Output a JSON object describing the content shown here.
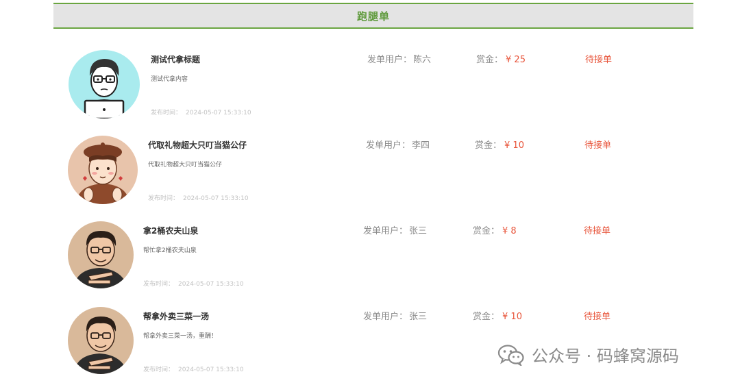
{
  "header": {
    "title": "跑腿单"
  },
  "labels": {
    "poster": "发单用户：",
    "reward": "赏金：",
    "time": "发布时间："
  },
  "orders": [
    {
      "title": "测试代拿标题",
      "content": "测试代拿内容",
      "time": "2024-05-07 15:33:10",
      "poster": "陈六",
      "reward": "¥ 25",
      "status": "待接单",
      "avatar": "cartoon-man-laptop"
    },
    {
      "title": "代取礼物超大只叮当猫公仔",
      "content": "代取礼物超大只叮当猫公仔",
      "time": "2024-05-07 15:33:10",
      "poster": "李四",
      "reward": "¥ 10",
      "status": "待接单",
      "avatar": "cartoon-boy-beret"
    },
    {
      "title": "拿2桶农夫山泉",
      "content": "帮忙拿2桶农夫山泉",
      "time": "2024-05-07 15:33:10",
      "poster": "张三",
      "reward": "¥ 8",
      "status": "待接单",
      "avatar": "cartoon-man-glasses"
    },
    {
      "title": "帮拿外卖三菜一汤",
      "content": "帮拿外卖三菜一汤，重酬！",
      "time": "2024-05-07 15:33:10",
      "poster": "张三",
      "reward": "¥ 10",
      "status": "待接单",
      "avatar": "cartoon-man-glasses"
    }
  ],
  "watermark": {
    "text": "公众号 · 码蜂窝源码",
    "icon": "wechat-icon"
  },
  "colors": {
    "accent_green": "#5f9a3c",
    "status_red": "#e8553b"
  }
}
